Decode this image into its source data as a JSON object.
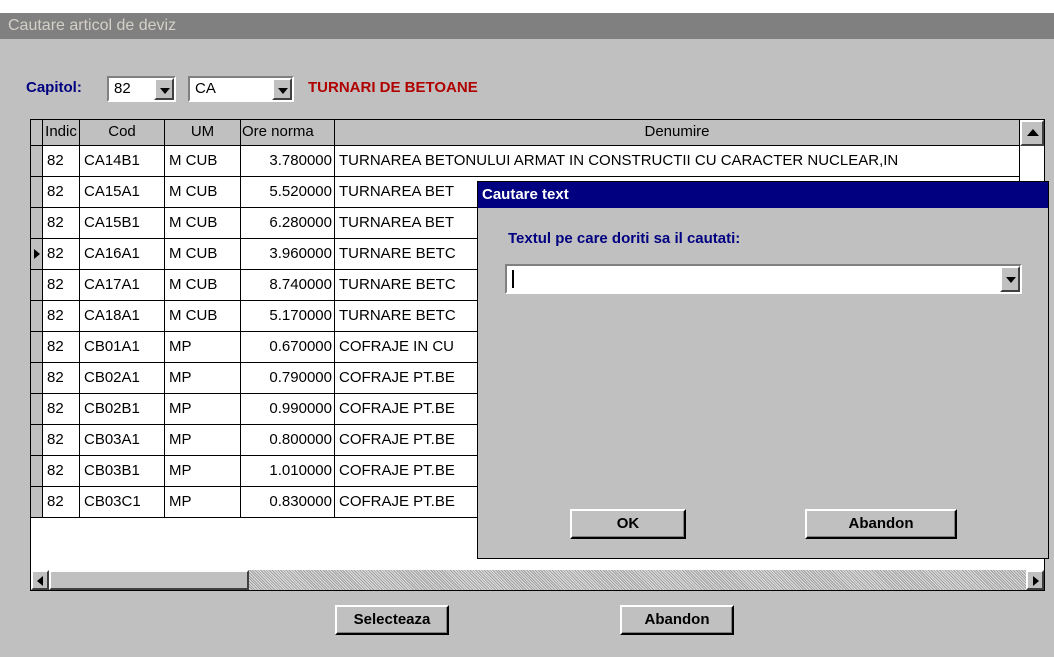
{
  "window": {
    "title": "Cautare articol de deviz"
  },
  "capitol": {
    "label": "Capitol:",
    "number": "82",
    "code": "CA",
    "name": "TURNARI DE BETOANE"
  },
  "grid": {
    "columns": [
      "Indic",
      "Cod",
      "UM",
      "Ore norma",
      "Denumire"
    ],
    "rows": [
      {
        "indic": "82",
        "cod": "CA14B1",
        "um": "M CUB",
        "ore": "3.780000",
        "denumire": "TURNAREA BETONULUI ARMAT IN CONSTRUCTII CU CARACTER NUCLEAR,IN"
      },
      {
        "indic": "82",
        "cod": "CA15A1",
        "um": "M CUB",
        "ore": "5.520000",
        "denumire": "TURNAREA BET"
      },
      {
        "indic": "82",
        "cod": "CA15B1",
        "um": "M CUB",
        "ore": "6.280000",
        "denumire": "TURNAREA BET"
      },
      {
        "indic": "82",
        "cod": "CA16A1",
        "um": "M CUB",
        "ore": "3.960000",
        "denumire": "TURNARE BETC"
      },
      {
        "indic": "82",
        "cod": "CA17A1",
        "um": "M CUB",
        "ore": "8.740000",
        "denumire": "TURNARE BETC"
      },
      {
        "indic": "82",
        "cod": "CA18A1",
        "um": "M CUB",
        "ore": "5.170000",
        "denumire": "TURNARE BETC"
      },
      {
        "indic": "82",
        "cod": "CB01A1",
        "um": "MP",
        "ore": "0.670000",
        "denumire": "COFRAJE IN CU"
      },
      {
        "indic": "82",
        "cod": "CB02A1",
        "um": "MP",
        "ore": "0.790000",
        "denumire": "COFRAJE PT.BE"
      },
      {
        "indic": "82",
        "cod": "CB02B1",
        "um": "MP",
        "ore": "0.990000",
        "denumire": "COFRAJE PT.BE"
      },
      {
        "indic": "82",
        "cod": "CB03A1",
        "um": "MP",
        "ore": "0.800000",
        "denumire": "COFRAJE PT.BE"
      },
      {
        "indic": "82",
        "cod": "CB03B1",
        "um": "MP",
        "ore": "1.010000",
        "denumire": "COFRAJE PT.BE"
      },
      {
        "indic": "82",
        "cod": "CB03C1",
        "um": "MP",
        "ore": "0.830000",
        "denumire": "COFRAJE PT.BE"
      }
    ],
    "current_row": 3
  },
  "buttons": {
    "select": "Selecteaza",
    "cancel": "Abandon"
  },
  "search_dialog": {
    "title": "Cautare text",
    "prompt": "Textul pe care doriti sa il cautati:",
    "value": "",
    "ok": "OK",
    "cancel": "Abandon"
  },
  "colors": {
    "window_bg": "#c0c0c0",
    "dialog_title_bg": "#000080",
    "label_blue": "#000080",
    "chapter_red": "#b00000",
    "inactive_title_bg": "#808080"
  }
}
